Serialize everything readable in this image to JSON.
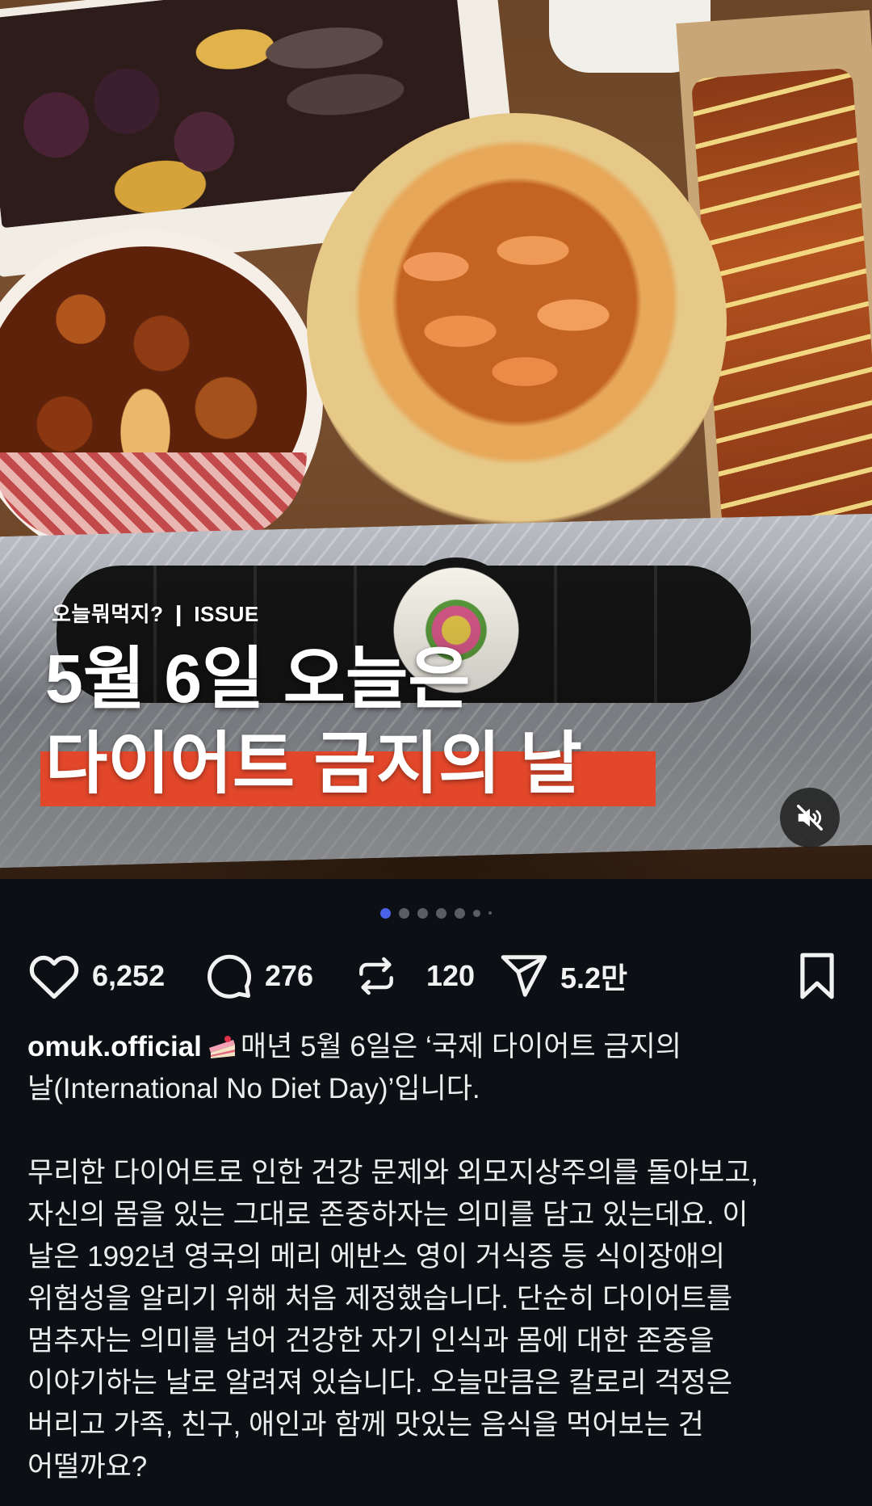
{
  "media": {
    "overlay_tag": "오늘뭐먹지? ❙ ISSUE",
    "overlay_title_line1": "5월 6일 오늘은",
    "overlay_title_line2": "다이어트 금지의 날",
    "highlight_color": "#e2472a",
    "mute_icon": "speaker-muted-icon"
  },
  "pagination": {
    "total_dots_visible": 7,
    "active_index": 0,
    "active_color": "#4a62e8"
  },
  "actions": {
    "like_count": "6,252",
    "comment_count": "276",
    "repost_count": "120",
    "share_count": "5.2만",
    "icons": [
      "heart-icon",
      "comment-icon",
      "repost-icon",
      "share-icon",
      "bookmark-icon"
    ]
  },
  "caption": {
    "username": "omuk.official",
    "emoji": "cake-slice-icon",
    "intro_line1": "매년 5월 6일은 ‘국제 다이어트 금지의",
    "intro_line2": "날(International No Diet Day)’입니다.",
    "body_lines": [
      "무리한 다이어트로 인한 건강 문제와 외모지상주의를 돌아보고,",
      "자신의 몸을 있는 그대로 존중하자는 의미를 담고 있는데요. 이",
      "날은 1992년 영국의 메리 에반스 영이 거식증 등 식이장애의",
      "위험성을 알리기 위해 처음 제정했습니다. 단순히 다이어트를",
      "멈추자는 의미를 넘어 건강한 자기 인식과 몸에 대한 존중을",
      "이야기하는 날로 알려져 있습니다. 오늘만큼은 칼로리 걱정은",
      "버리고 가족, 친구, 애인과 함께 맛있는 음식을 먹어보는 건",
      "어떨까요?"
    ]
  }
}
